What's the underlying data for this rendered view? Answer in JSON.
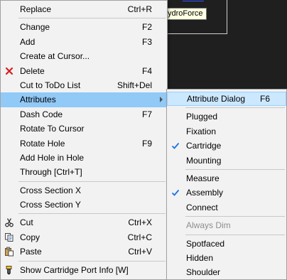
{
  "tooltip": {
    "text": "ydroForce"
  },
  "main_menu": {
    "replace": {
      "label": "Replace",
      "shortcut": "Ctrl+R"
    },
    "change": {
      "label": "Change",
      "shortcut": "F2"
    },
    "add": {
      "label": "Add",
      "shortcut": "F3"
    },
    "create_at_cursor": {
      "label": "Create at Cursor..."
    },
    "delete": {
      "label": "Delete",
      "shortcut": "F4",
      "icon": "red-x-icon"
    },
    "cut_to_todo": {
      "label": "Cut to ToDo List",
      "shortcut": "Shift+Del"
    },
    "attributes": {
      "label": "Attributes"
    },
    "dash_code": {
      "label": "Dash Code",
      "shortcut": "F7"
    },
    "rotate_to_cursor": {
      "label": "Rotate To Cursor"
    },
    "rotate_hole": {
      "label": "Rotate Hole",
      "shortcut": "F9"
    },
    "add_hole_in_hole": {
      "label": "Add Hole in Hole"
    },
    "through": {
      "label": "Through  [Ctrl+T]"
    },
    "cross_section_x": {
      "label": "Cross Section X"
    },
    "cross_section_y": {
      "label": "Cross Section Y"
    },
    "cut": {
      "label": "Cut",
      "shortcut": "Ctrl+X",
      "icon": "scissors-icon"
    },
    "copy": {
      "label": "Copy",
      "shortcut": "Ctrl+C",
      "icon": "copy-icon"
    },
    "paste": {
      "label": "Paste",
      "shortcut": "Ctrl+V",
      "icon": "paste-icon"
    },
    "show_port_info": {
      "label": "Show Cartridge Port Info  [W]",
      "icon": "cartridge-port-icon"
    }
  },
  "sub_menu": {
    "attribute_dialog": {
      "label": "Attribute Dialog",
      "shortcut": "F6"
    },
    "plugged": {
      "label": "Plugged",
      "checked": false
    },
    "fixation": {
      "label": "Fixation",
      "checked": false
    },
    "cartridge": {
      "label": "Cartridge",
      "checked": true
    },
    "mounting": {
      "label": "Mounting",
      "checked": false
    },
    "measure": {
      "label": "Measure",
      "checked": false
    },
    "assembly": {
      "label": "Assembly",
      "checked": true
    },
    "connect": {
      "label": "Connect",
      "checked": false
    },
    "always_dim": {
      "label": "Always Dim",
      "disabled": true
    },
    "spotfaced": {
      "label": "Spotfaced"
    },
    "hidden": {
      "label": "Hidden"
    },
    "shoulder": {
      "label": "Shoulder"
    }
  },
  "colors": {
    "highlight": "#91c9f7",
    "submenu_highlight": "#cce8ff",
    "check": "#1a73e8",
    "delete_icon": "#d42020"
  }
}
